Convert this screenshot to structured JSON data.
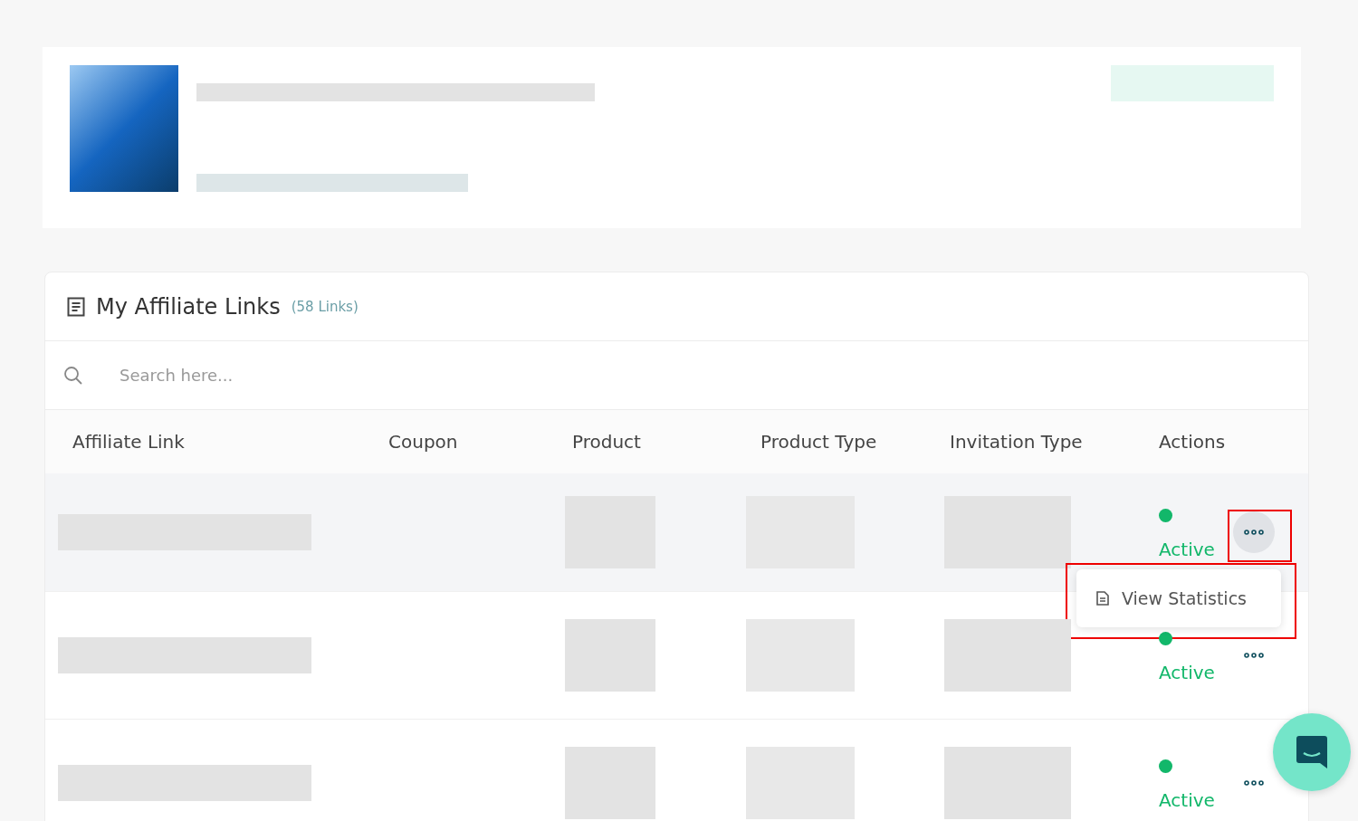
{
  "links_panel": {
    "title": "My Affiliate Links",
    "count": "(58 Links)",
    "search": {
      "placeholder": "Search here..."
    },
    "columns": [
      "Affiliate Link",
      "Coupon",
      "Product",
      "Product Type",
      "Invitation Type",
      "Actions"
    ],
    "rows": [
      {
        "status": "Active",
        "color": "#12b76a",
        "highlighted": true,
        "menu_open": true
      },
      {
        "status": "Active",
        "color": "#12b76a",
        "highlighted": false,
        "menu_open": false
      },
      {
        "status": "Active",
        "color": "#12b76a",
        "highlighted": false,
        "menu_open": false
      }
    ],
    "row_menu": {
      "items": [
        "View Statistics"
      ]
    }
  }
}
